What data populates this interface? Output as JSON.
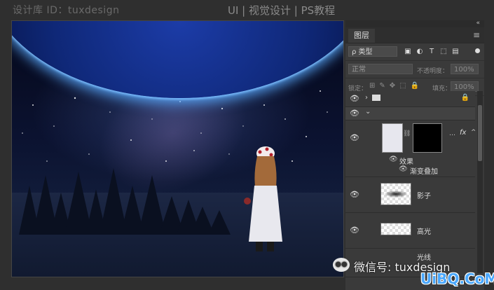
{
  "watermark_top": "设计库 ID：tuxdesign",
  "header_title": "UI | 视觉设计 | PS教程",
  "panel": {
    "collapse_glyph": "«",
    "menu_glyph": "≡",
    "tab_label": "图层",
    "filter_kind": "ρ 类型",
    "filter_icons": [
      "image-filter-icon",
      "adjustment-filter-icon",
      "type-filter-icon",
      "shape-filter-icon",
      "smartobject-filter-icon"
    ],
    "filter_glyphs": [
      "▣",
      "◐",
      "T",
      "⬚",
      "▤"
    ],
    "blend_mode": "正常",
    "opacity_label": "不透明度：",
    "opacity_value": "100%",
    "lock_label": "锁定：",
    "lock_glyphs": [
      "⊞",
      "✎",
      "✥",
      "⬚",
      "🔒"
    ],
    "fill_label": "填充：",
    "fill_value": "100%"
  },
  "layers": {
    "group_row_glyph": "›",
    "open_group_glyph": "⌄",
    "fx_label": "fx",
    "effects_label": "效果",
    "gradient_overlay_label": "渐变叠加",
    "shadow_label": "影子",
    "highlight_label": "高光",
    "next_label": "光线"
  },
  "watermark_bottom": "微信号: tuxdesign",
  "site_watermark": "UiBQ.CoM"
}
